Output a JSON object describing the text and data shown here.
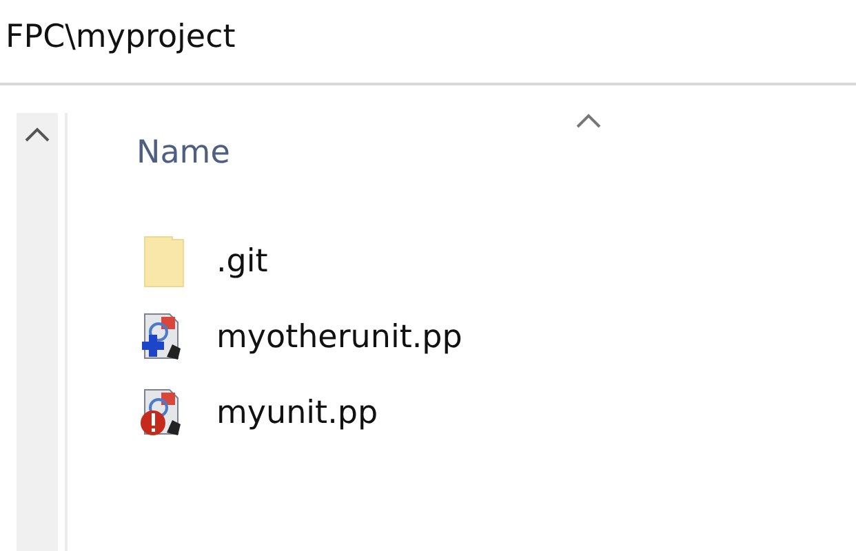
{
  "address_bar": {
    "path": "FPC\\myproject"
  },
  "file_list": {
    "columns": [
      {
        "label": "Name",
        "sorted": true
      }
    ],
    "rows": [
      {
        "name": ".git",
        "kind": "folder"
      },
      {
        "name": "myotherunit.pp",
        "kind": "added"
      },
      {
        "name": "myunit.pp",
        "kind": "conflict"
      }
    ]
  }
}
